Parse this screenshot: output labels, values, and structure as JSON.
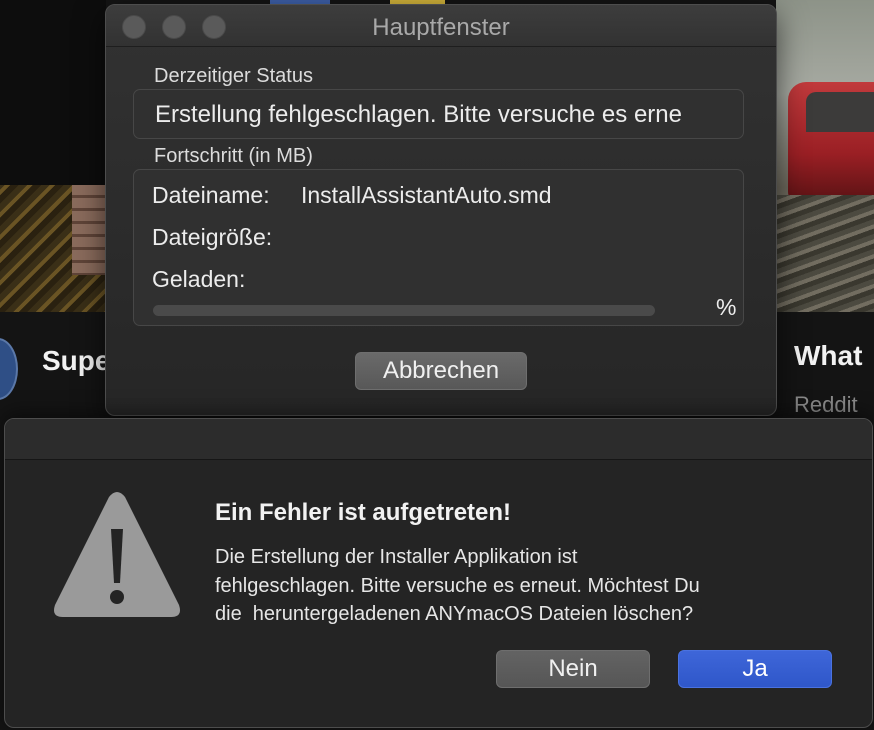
{
  "background": {
    "left_title": "Super Rand",
    "right_title": "What",
    "right_subtitle": "Reddit"
  },
  "main_window": {
    "title": "Hauptfenster",
    "status_label": "Derzeitiger Status",
    "status_value": "Erstellung fehlgeschlagen. Bitte versuche es erneut.",
    "progress_label": "Fortschritt (in MB)",
    "file_name_label": "Dateiname:",
    "file_name_value": "InstallAssistantAuto.smd",
    "file_size_label": "Dateigröße:",
    "file_size_value": "",
    "loaded_label": "Geladen:",
    "loaded_value": "",
    "progress_fraction": 0,
    "percent_sign": "%",
    "cancel_button": "Abbrechen"
  },
  "alert": {
    "title": "Ein Fehler ist aufgetreten!",
    "message_lines": [
      "Die Erstellung der Installer Applikation ist",
      "fehlgeschlagen. Bitte versuche es erneut. Möchtest Du",
      "die  heruntergeladenen ANYmacOS Dateien löschen?"
    ],
    "no_button": "Nein",
    "yes_button": "Ja"
  },
  "colors": {
    "accent": "#2f57c9",
    "window_bg": "#262626",
    "alert_bg": "#242424",
    "warning_icon": "#9a9a9a"
  },
  "icons": {
    "alert_icon": "warning-triangle-icon"
  }
}
